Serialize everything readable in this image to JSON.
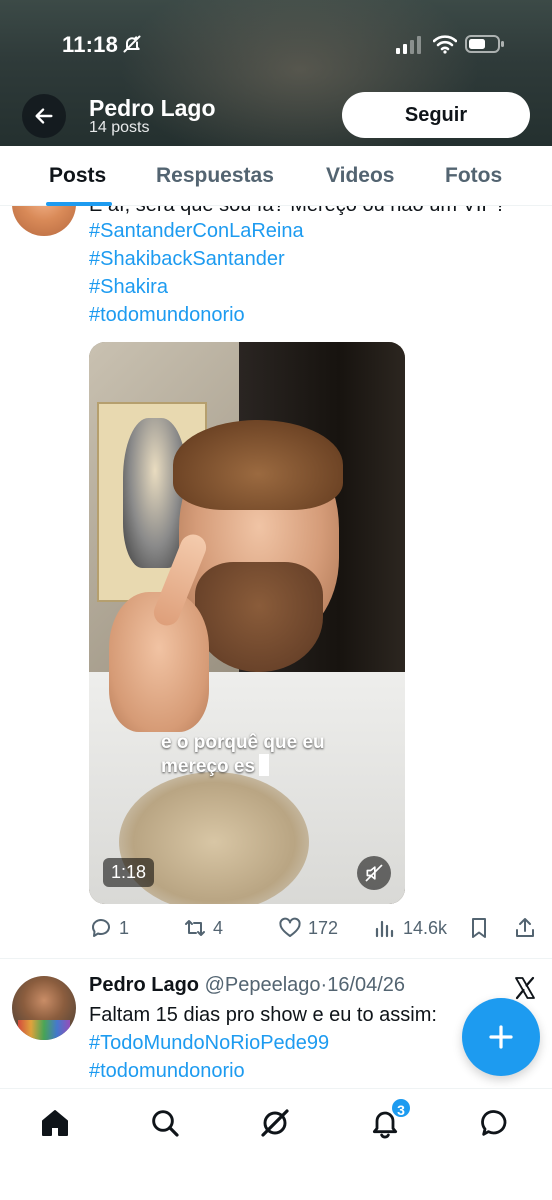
{
  "status_bar": {
    "time": "11:18"
  },
  "header": {
    "name": "Pedro Lago",
    "posts_count": "14 posts",
    "follow_label": "Seguir"
  },
  "tabs": [
    {
      "label": "Posts",
      "active": true
    },
    {
      "label": "Respuestas",
      "active": false
    },
    {
      "label": "Videos",
      "active": false
    },
    {
      "label": "Fotos",
      "active": false
    }
  ],
  "post1": {
    "cut_text": "E aí, será que sou fã? Mereço ou não um VIP?",
    "hashtags": [
      "#SantanderConLaReina",
      "#ShakibackSantander",
      "#Shakira",
      "#todomundonorio"
    ],
    "video": {
      "caption_line1": "e o porquê que eu",
      "caption_line2": "mereço es",
      "duration": "1:18"
    },
    "stats": {
      "replies": "1",
      "reposts": "4",
      "likes": "172",
      "views": "14.6k"
    }
  },
  "post2": {
    "name": "Pedro Lago",
    "handle": "@Pepeelago",
    "separator": "·",
    "date": "16/04/26",
    "text": "Faltam 15 dias pro show e eu to assim:",
    "hashtags": [
      "#TodoMundoNoRioPede99",
      "#todomundonorio"
    ]
  },
  "bottom_nav": {
    "notifications_badge": "3"
  },
  "colors": {
    "accent": "#1d9bf0",
    "text": "#0f1419",
    "muted": "#536471"
  }
}
